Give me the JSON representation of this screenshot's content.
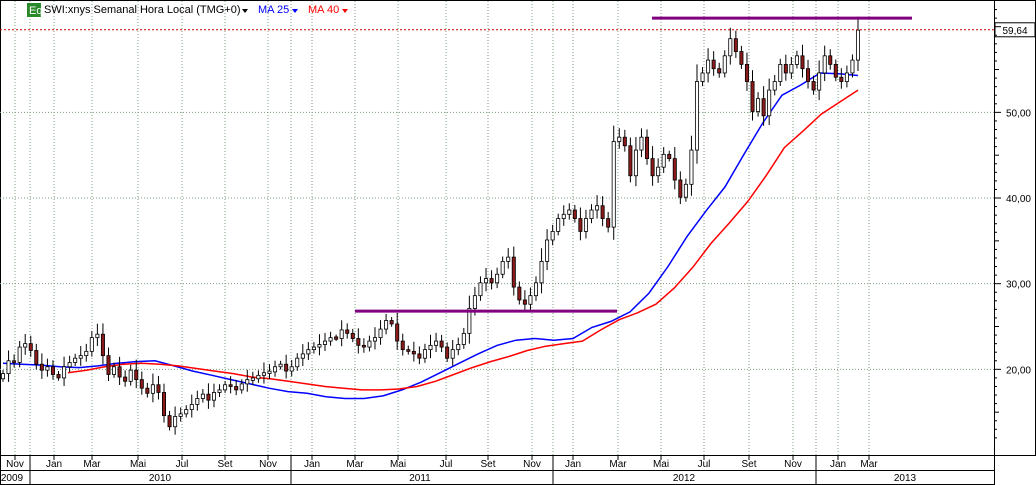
{
  "header": {
    "icon_label": "Eq",
    "symbol_label": "SWI:xnys Semanal Hora Local (TMG+0)",
    "ma_short_label": "MA 25",
    "ma_long_label": "MA 40"
  },
  "colors": {
    "up_candle": "#ffffff",
    "down_candle": "#8b1a1a",
    "ma25": "#0000ff",
    "ma40": "#ff0000",
    "resistance": "#800080",
    "price_line": "#cc0000",
    "grid": "#7f9f7f",
    "icon_bg": "#2a8a2a"
  },
  "chart_data": {
    "type": "candlestick",
    "title": "SWI:xnys Semanal Hora Local (TMG+0)",
    "ylim": [
      10,
      63
    ],
    "y_ticks": [
      20,
      30,
      40,
      50
    ],
    "y_tick_labels": [
      "20,00",
      "30,00",
      "40,00",
      "50,00"
    ],
    "last_price_label": "59,64",
    "last_price": 59.64,
    "grid": true,
    "x_month_labels": [
      "Nov",
      "Jan",
      "Mar",
      "Mai",
      "Jul",
      "Set",
      "Nov",
      "Jan",
      "Mar",
      "Mai",
      "Jul",
      "Set",
      "Nov",
      "Jan",
      "Mar",
      "Mai",
      "Jul",
      "Set",
      "Nov",
      "Jan",
      "Mar"
    ],
    "x_year_labels": [
      "2009",
      "2010",
      "2011",
      "2012",
      "2013"
    ],
    "weekly_close": [
      19.5,
      21.0,
      20.8,
      22.6,
      23.0,
      22.2,
      20.6,
      19.9,
      20.3,
      19.4,
      19.0,
      20.3,
      20.8,
      21.3,
      21.6,
      22.1,
      23.7,
      24.1,
      21.6,
      19.4,
      20.3,
      19.1,
      18.6,
      19.9,
      18.8,
      17.8,
      17.2,
      18.2,
      17.3,
      14.6,
      13.3,
      14.5,
      14.8,
      15.3,
      15.9,
      16.6,
      17.1,
      16.4,
      17.3,
      17.6,
      18.2,
      18.0,
      17.6,
      18.3,
      18.8,
      18.9,
      19.3,
      19.6,
      19.7,
      20.3,
      20.6,
      19.8,
      20.3,
      21.3,
      21.8,
      22.3,
      22.6,
      22.9,
      23.3,
      23.7,
      23.6,
      24.6,
      24.2,
      23.6,
      22.8,
      22.6,
      23.3,
      23.7,
      24.7,
      25.7,
      25.3,
      23.3,
      22.3,
      22.1,
      21.8,
      21.3,
      22.3,
      22.8,
      23.3,
      22.6,
      21.3,
      22.3,
      22.9,
      24.2,
      27.1,
      28.6,
      30.1,
      30.6,
      30.1,
      31.1,
      32.6,
      33.1,
      29.6,
      28.1,
      27.6,
      28.6,
      30.1,
      32.6,
      35.1,
      36.1,
      37.6,
      38.1,
      38.6,
      37.6,
      36.1,
      37.6,
      38.6,
      39.1,
      37.6,
      36.6,
      46.6,
      47.1,
      46.1,
      42.6,
      45.6,
      47.1,
      44.6,
      42.6,
      43.6,
      45.1,
      44.6,
      42.1,
      40.1,
      41.6,
      45.6,
      53.6,
      54.6,
      56.1,
      55.1,
      54.6,
      56.6,
      58.6,
      57.1,
      55.6,
      53.6,
      50.1,
      51.6,
      49.6,
      52.6,
      53.6,
      55.6,
      54.6,
      55.6,
      56.6,
      55.1,
      53.6,
      52.6,
      54.6,
      56.6,
      55.6,
      54.1,
      53.6,
      54.6,
      56.1,
      59.6
    ],
    "series": [
      {
        "name": "MA 25",
        "values": [
          20.7,
          20.6,
          20.5,
          20.3,
          20.2,
          20.4,
          20.7,
          20.9,
          21.0,
          20.4,
          19.8,
          19.3,
          18.8,
          18.3,
          17.8,
          17.4,
          17.2,
          16.8,
          16.6,
          16.6,
          16.9,
          17.6,
          18.5,
          19.6,
          20.7,
          21.8,
          22.8,
          23.4,
          23.6,
          23.4,
          23.6,
          24.9,
          25.6,
          26.7,
          28.9,
          32.0,
          35.5,
          38.5,
          41.3,
          45.1,
          48.8,
          52.0,
          53.2,
          54.6,
          54.5,
          54.3
        ]
      },
      {
        "name": "MA 40",
        "values": [
          19.6,
          19.9,
          20.3,
          20.6,
          20.7,
          20.6,
          20.4,
          20.1,
          19.8,
          19.5,
          19.1,
          18.9,
          18.6,
          18.3,
          18.0,
          17.8,
          17.6,
          17.6,
          17.7,
          18.0,
          18.6,
          19.4,
          20.2,
          20.9,
          21.5,
          22.2,
          22.7,
          23.0,
          23.3,
          24.6,
          25.8,
          26.6,
          27.6,
          29.5,
          31.9,
          34.7,
          37.1,
          39.6,
          42.6,
          45.9,
          47.8,
          49.8,
          51.2,
          52.6
        ]
      }
    ],
    "resistance_levels": [
      {
        "value": 26.8
      },
      {
        "value": 61.0
      }
    ]
  }
}
